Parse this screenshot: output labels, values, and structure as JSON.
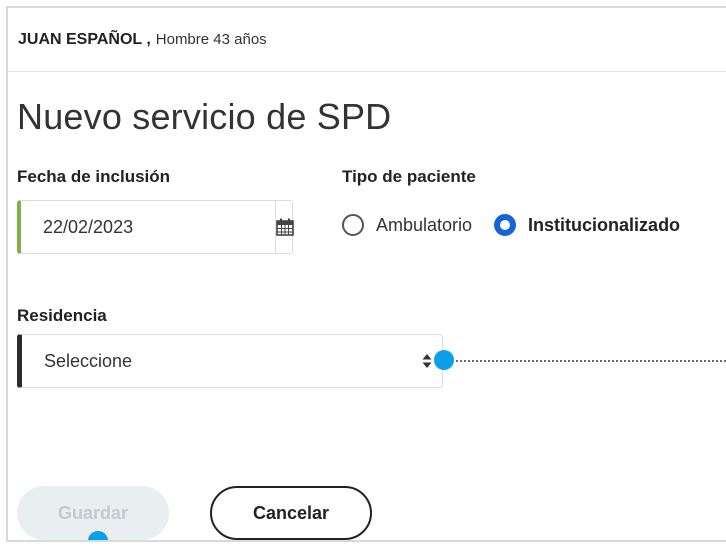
{
  "patient": {
    "name": "JUAN ESPAÑOL ,",
    "info": "Hombre 43 años"
  },
  "page": {
    "title": "Nuevo servicio de SPD"
  },
  "form": {
    "fecha_label": "Fecha de inclusión",
    "fecha_value": "22/02/2023",
    "tipo_label": "Tipo de paciente",
    "tipo_options": [
      {
        "label": "Ambulatorio",
        "selected": false
      },
      {
        "label": "Institucionalizado",
        "selected": true
      }
    ],
    "residencia_label": "Residencia",
    "residencia_value": "Seleccione"
  },
  "actions": {
    "save_label": "Guardar",
    "save_enabled": false,
    "cancel_label": "Cancelar"
  },
  "colors": {
    "accent": "#1565d8",
    "valid": "#7cb342",
    "marker": "#0aa0e8",
    "disabled_bg": "#e9eef0"
  },
  "icons": {
    "date_picker": "calendar-icon",
    "select": "sort-arrows-icon"
  }
}
